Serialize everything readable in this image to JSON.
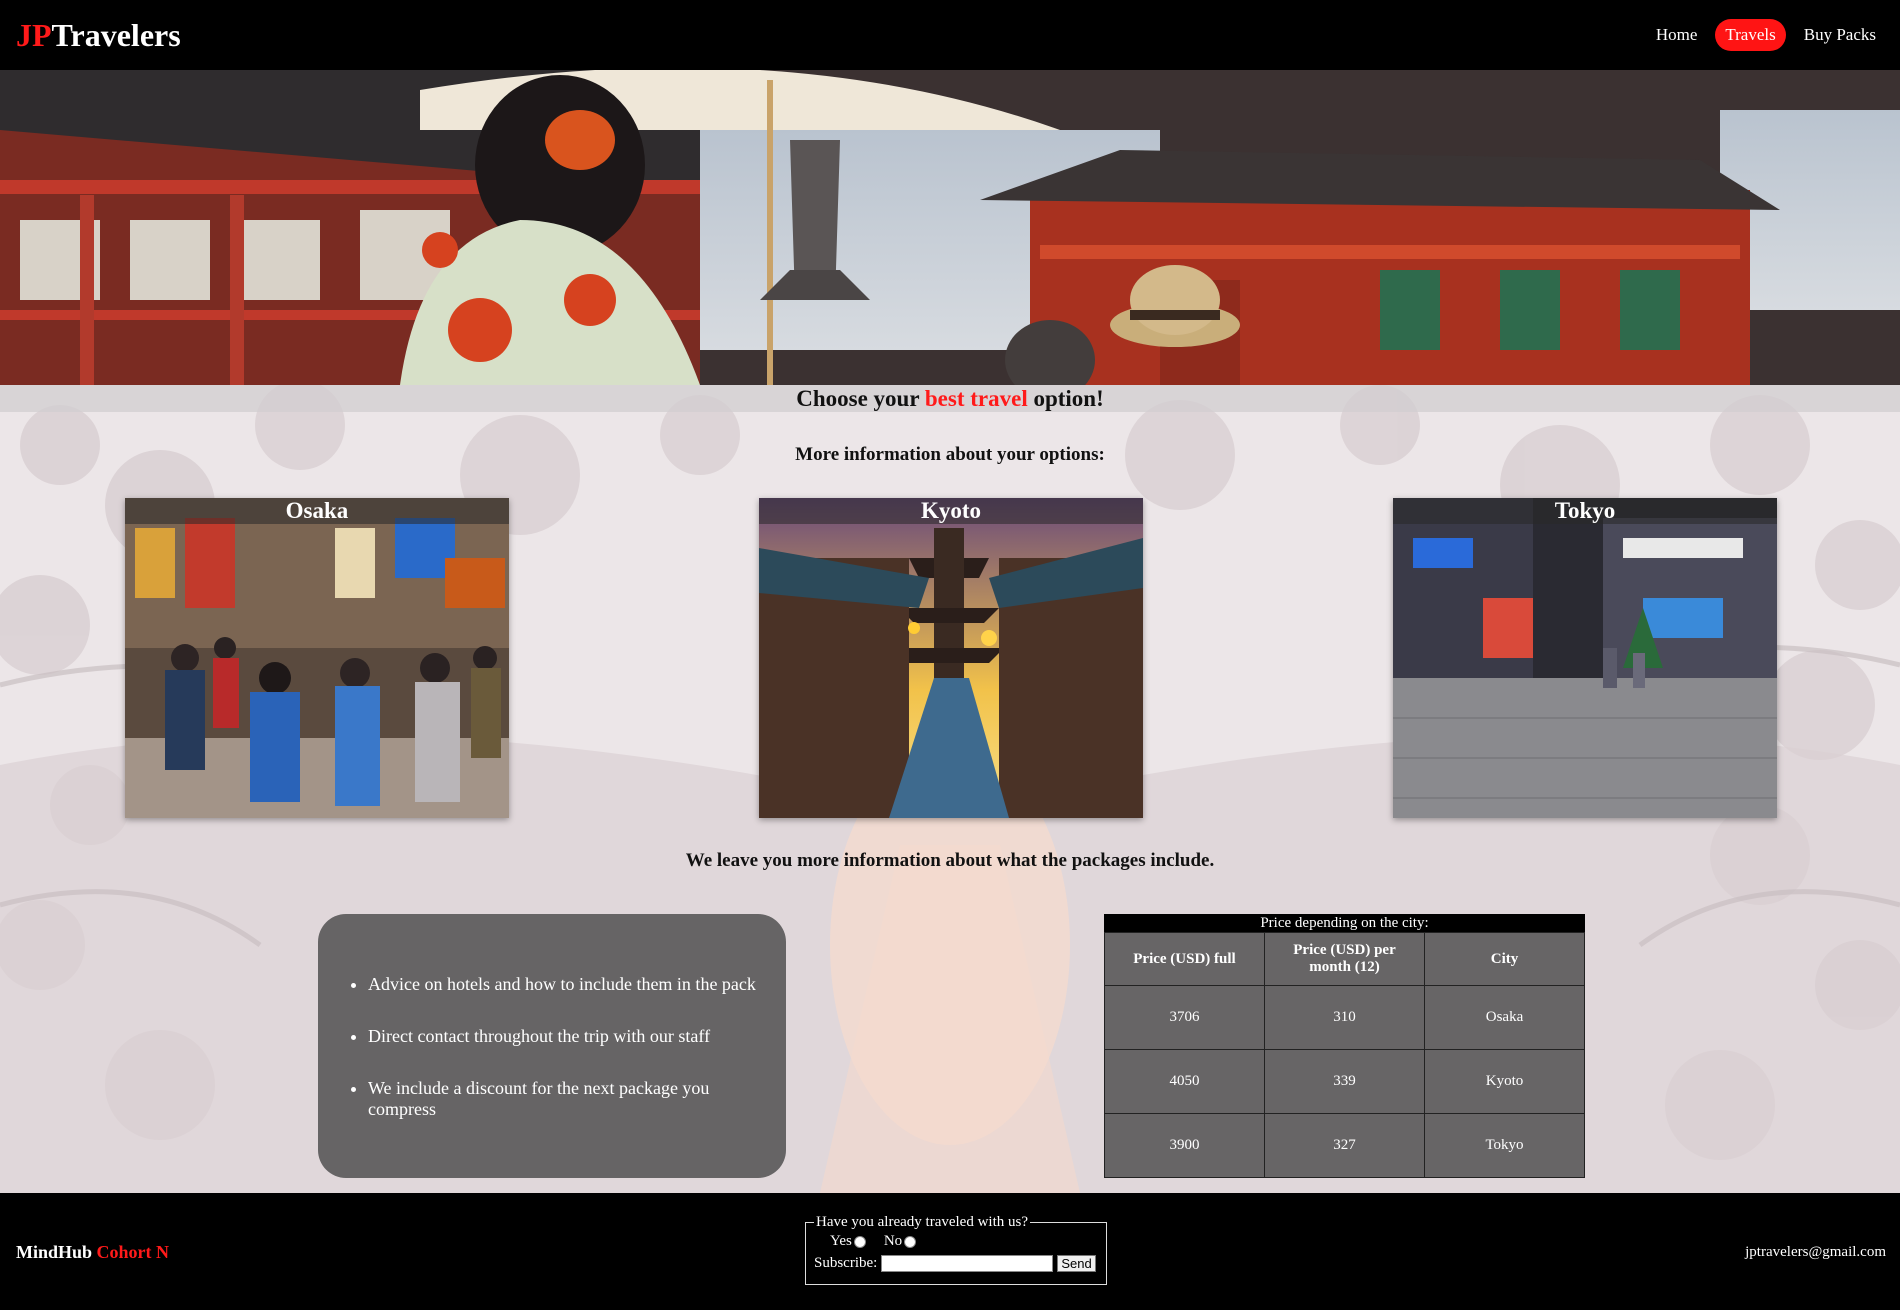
{
  "navbar": {
    "brand_accent": "JP",
    "brand_rest": "Travelers",
    "links": [
      {
        "label": "Home",
        "active": false
      },
      {
        "label": "Travels",
        "active": true
      },
      {
        "label": "Buy Packs",
        "active": false
      }
    ]
  },
  "main": {
    "banner": {
      "before": "Choose your ",
      "highlight": "best travel",
      "after": " option!"
    },
    "options_intro": "More information about your options:",
    "cities": [
      {
        "name": "Osaka"
      },
      {
        "name": "Kyoto"
      },
      {
        "name": "Tokyo"
      }
    ],
    "packages_intro": "We leave you more information about what the packages include.",
    "includes": [
      "Advice on hotels and how to include them in the pack",
      "Direct contact throughout the trip with our staff",
      "We include a discount for the next package you compress"
    ],
    "price_table": {
      "caption": "Price depending on the city:",
      "headers": [
        "Price (USD) full",
        "Price (USD) per month (12)",
        "City"
      ],
      "rows": [
        [
          "3706",
          "310",
          "Osaka"
        ],
        [
          "4050",
          "339",
          "Kyoto"
        ],
        [
          "3900",
          "327",
          "Tokyo"
        ]
      ]
    }
  },
  "footer": {
    "left_main": "MindHub",
    "left_accent": "Cohort N",
    "survey": {
      "legend": "Have you already traveled with us?",
      "yes_label": "Yes",
      "no_label": "No",
      "subscribe_label": "Subscribe:",
      "send_label": "Send"
    },
    "email": "jptravelers@gmail.com"
  },
  "colors": {
    "accent": "#ff1a1a",
    "navbar_bg": "#000000",
    "panel_bg": "#555555"
  }
}
